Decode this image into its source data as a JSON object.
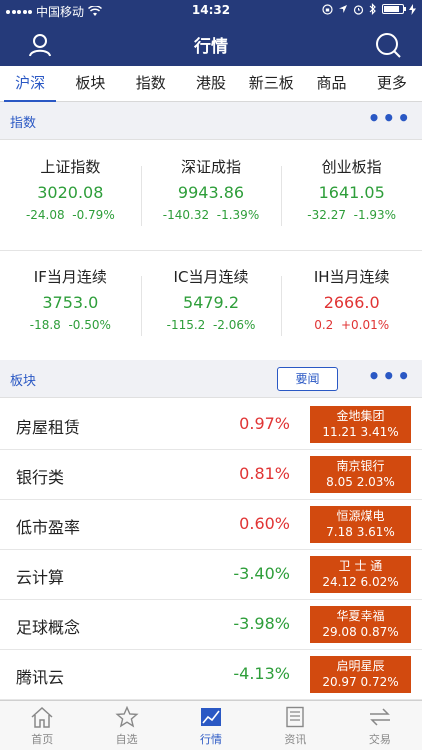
{
  "status_bar": {
    "carrier": "中国移动",
    "time": "14:32",
    "battery_level": 0.85
  },
  "nav": {
    "title": "行情",
    "left_icon": "user-icon",
    "right_icon": "search-icon"
  },
  "tabs": [
    {
      "label": "沪深",
      "active": true
    },
    {
      "label": "板块",
      "active": false
    },
    {
      "label": "指数",
      "active": false
    },
    {
      "label": "港股",
      "active": false
    },
    {
      "label": "新三板",
      "active": false
    },
    {
      "label": "商品",
      "active": false
    },
    {
      "label": "更多",
      "active": false
    }
  ],
  "index_section": {
    "label": "指数",
    "more": "•••"
  },
  "indices": [
    {
      "name": "上证指数",
      "value": "3020.08",
      "change": "-24.08",
      "percent": "-0.79%",
      "trend": "down"
    },
    {
      "name": "深证成指",
      "value": "9943.86",
      "change": "-140.32",
      "percent": "-1.39%",
      "trend": "down"
    },
    {
      "name": "创业板指",
      "value": "1641.05",
      "change": "-32.27",
      "percent": "-1.93%",
      "trend": "down"
    },
    {
      "name": "IF当月连续",
      "value": "3753.0",
      "change": "-18.8",
      "percent": "-0.50%",
      "trend": "down"
    },
    {
      "name": "IC当月连续",
      "value": "5479.2",
      "change": "-115.2",
      "percent": "-2.06%",
      "trend": "down"
    },
    {
      "name": "IH当月连续",
      "value": "2666.0",
      "change": "0.2",
      "percent": "+0.01%",
      "trend": "up"
    }
  ],
  "sector_section": {
    "label": "板块",
    "news_button": "要闻",
    "more": "•••"
  },
  "sectors": [
    {
      "name": "房屋租赁",
      "percent": "0.97%",
      "trend": "up",
      "leader_name": "金地集团",
      "leader_price": "11.21",
      "leader_percent": "3.41%"
    },
    {
      "name": "银行类",
      "percent": "0.81%",
      "trend": "up",
      "leader_name": "南京银行",
      "leader_price": "8.05",
      "leader_percent": "2.03%"
    },
    {
      "name": "低市盈率",
      "percent": "0.60%",
      "trend": "up",
      "leader_name": "恒源煤电",
      "leader_price": "7.18",
      "leader_percent": "3.61%"
    },
    {
      "name": "云计算",
      "percent": "-3.40%",
      "trend": "down",
      "leader_name": "卫 士 通",
      "leader_price": "24.12",
      "leader_percent": "6.02%"
    },
    {
      "name": "足球概念",
      "percent": "-3.98%",
      "trend": "down",
      "leader_name": "华夏幸福",
      "leader_price": "29.08",
      "leader_percent": "0.87%"
    },
    {
      "name": "腾讯云",
      "percent": "-4.13%",
      "trend": "down",
      "leader_name": "启明星辰",
      "leader_price": "20.97",
      "leader_percent": "0.72%"
    }
  ],
  "bottom_tabs": [
    {
      "label": "首页",
      "icon": "home-icon",
      "active": false
    },
    {
      "label": "自选",
      "icon": "star-icon",
      "active": false
    },
    {
      "label": "行情",
      "icon": "chart-icon",
      "active": true
    },
    {
      "label": "资讯",
      "icon": "news-icon",
      "active": false
    },
    {
      "label": "交易",
      "icon": "exchange-icon",
      "active": false
    }
  ],
  "colors": {
    "primary": "#253a7a",
    "accent": "#2a58c4",
    "up": "#e03434",
    "down": "#2e9e3a",
    "leader_bg": "#d24a0f"
  }
}
